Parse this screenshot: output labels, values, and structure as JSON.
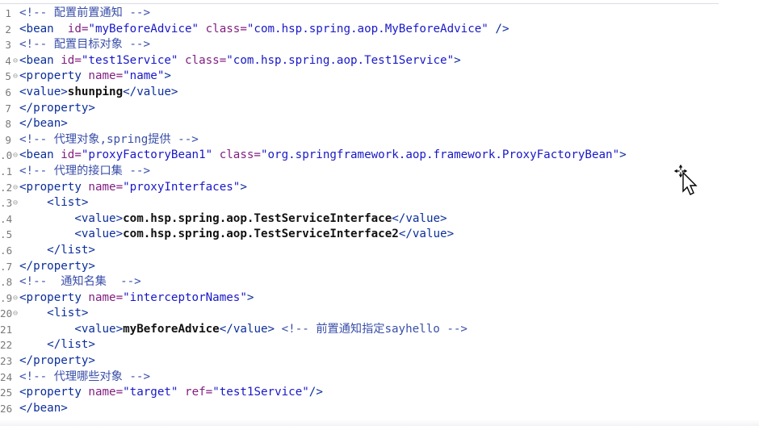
{
  "editor": {
    "lines": [
      {
        "number": "1",
        "fold": "",
        "indent": "",
        "segments": [
          {
            "t": "comment",
            "v": "<!-- 配置前置通知 -->"
          }
        ]
      },
      {
        "number": "2",
        "fold": "",
        "indent": "",
        "segments": [
          {
            "t": "tag",
            "v": "<bean  "
          },
          {
            "t": "attr",
            "v": "id="
          },
          {
            "t": "val",
            "v": "\"myBeforeAdvice\""
          },
          {
            "t": "tag",
            "v": " "
          },
          {
            "t": "attr",
            "v": "class="
          },
          {
            "t": "val",
            "v": "\"com.hsp.spring.aop.MyBeforeAdvice\""
          },
          {
            "t": "tag",
            "v": " />"
          }
        ]
      },
      {
        "number": "3",
        "fold": "",
        "indent": "",
        "segments": [
          {
            "t": "comment",
            "v": "<!-- 配置目标对象 -->"
          }
        ]
      },
      {
        "number": "4",
        "fold": "⊖",
        "indent": "",
        "segments": [
          {
            "t": "tag",
            "v": "<bean "
          },
          {
            "t": "attr",
            "v": "id="
          },
          {
            "t": "val",
            "v": "\"test1Service\""
          },
          {
            "t": "tag",
            "v": " "
          },
          {
            "t": "attr",
            "v": "class="
          },
          {
            "t": "val",
            "v": "\"com.hsp.spring.aop.Test1Service\""
          },
          {
            "t": "tag",
            "v": ">"
          }
        ]
      },
      {
        "number": "5",
        "fold": "⊖",
        "indent": "",
        "segments": [
          {
            "t": "tag",
            "v": "<property "
          },
          {
            "t": "attr",
            "v": "name="
          },
          {
            "t": "val",
            "v": "\"name\""
          },
          {
            "t": "tag",
            "v": ">"
          }
        ]
      },
      {
        "number": "6",
        "fold": "",
        "indent": "",
        "segments": [
          {
            "t": "tag",
            "v": "<value>"
          },
          {
            "t": "text",
            "v": "shunping"
          },
          {
            "t": "tag",
            "v": "</value>"
          }
        ]
      },
      {
        "number": "7",
        "fold": "",
        "indent": "",
        "segments": [
          {
            "t": "tag",
            "v": "</property>"
          }
        ]
      },
      {
        "number": "8",
        "fold": "",
        "indent": "",
        "segments": [
          {
            "t": "tag",
            "v": "</bean>"
          }
        ]
      },
      {
        "number": "9",
        "fold": "",
        "indent": "",
        "segments": [
          {
            "t": "comment",
            "v": "<!-- 代理对象,spring提供 -->"
          }
        ]
      },
      {
        "number": ".0",
        "fold": "⊖",
        "indent": "",
        "segments": [
          {
            "t": "tag",
            "v": "<bean "
          },
          {
            "t": "attr",
            "v": "id="
          },
          {
            "t": "val",
            "v": "\"proxyFactoryBean1\""
          },
          {
            "t": "tag",
            "v": " "
          },
          {
            "t": "attr",
            "v": "class="
          },
          {
            "t": "val",
            "v": "\"org.springframework.aop.framework.ProxyFactoryBean\""
          },
          {
            "t": "tag",
            "v": ">"
          }
        ]
      },
      {
        "number": ".1",
        "fold": "",
        "indent": "",
        "segments": [
          {
            "t": "comment",
            "v": "<!-- 代理的接口集 -->"
          }
        ]
      },
      {
        "number": ".2",
        "fold": "⊖",
        "indent": "",
        "segments": [
          {
            "t": "tag",
            "v": "<property "
          },
          {
            "t": "attr",
            "v": "name="
          },
          {
            "t": "val",
            "v": "\"proxyInterfaces\""
          },
          {
            "t": "tag",
            "v": ">"
          }
        ]
      },
      {
        "number": ".3",
        "fold": "⊖",
        "indent": "    ",
        "segments": [
          {
            "t": "tag",
            "v": "<list>"
          }
        ]
      },
      {
        "number": ".4",
        "fold": "",
        "indent": "        ",
        "segments": [
          {
            "t": "tag",
            "v": "<value>"
          },
          {
            "t": "text",
            "v": "com.hsp.spring.aop.TestServiceInterface"
          },
          {
            "t": "tag",
            "v": "</value>"
          }
        ]
      },
      {
        "number": ".5",
        "fold": "",
        "indent": "        ",
        "segments": [
          {
            "t": "tag",
            "v": "<value>"
          },
          {
            "t": "text",
            "v": "com.hsp.spring.aop.TestServiceInterface2"
          },
          {
            "t": "tag",
            "v": "</value>"
          }
        ]
      },
      {
        "number": ".6",
        "fold": "",
        "indent": "    ",
        "segments": [
          {
            "t": "tag",
            "v": "</list>"
          }
        ]
      },
      {
        "number": ".7",
        "fold": "",
        "indent": "",
        "segments": [
          {
            "t": "tag",
            "v": "</property>"
          }
        ]
      },
      {
        "number": ".8",
        "fold": "",
        "indent": "",
        "segments": [
          {
            "t": "comment",
            "v": "<!--  通知名集  -->"
          }
        ]
      },
      {
        "number": ".9",
        "fold": "⊖",
        "indent": "",
        "segments": [
          {
            "t": "tag",
            "v": "<property "
          },
          {
            "t": "attr",
            "v": "name="
          },
          {
            "t": "val",
            "v": "\"interceptorNames\""
          },
          {
            "t": "tag",
            "v": ">"
          }
        ]
      },
      {
        "number": "20",
        "fold": "⊖",
        "indent": "    ",
        "segments": [
          {
            "t": "tag",
            "v": "<list>"
          }
        ]
      },
      {
        "number": "21",
        "fold": "",
        "indent": "        ",
        "segments": [
          {
            "t": "tag",
            "v": "<value>"
          },
          {
            "t": "text",
            "v": "myBeforeAdvice"
          },
          {
            "t": "tag",
            "v": "</value> "
          },
          {
            "t": "comment",
            "v": "<!-- 前置通知指定sayhello -->"
          }
        ]
      },
      {
        "number": "22",
        "fold": "",
        "indent": "    ",
        "segments": [
          {
            "t": "tag",
            "v": "</list>"
          }
        ]
      },
      {
        "number": "23",
        "fold": "",
        "indent": "",
        "segments": [
          {
            "t": "tag",
            "v": "</property>"
          }
        ]
      },
      {
        "number": "24",
        "fold": "",
        "indent": "",
        "segments": [
          {
            "t": "comment",
            "v": "<!-- 代理哪些对象 -->"
          }
        ]
      },
      {
        "number": "25",
        "fold": "",
        "indent": "",
        "segments": [
          {
            "t": "tag",
            "v": "<property "
          },
          {
            "t": "attr",
            "v": "name="
          },
          {
            "t": "val",
            "v": "\"target\""
          },
          {
            "t": "tag",
            "v": " "
          },
          {
            "t": "attr",
            "v": "ref="
          },
          {
            "t": "val",
            "v": "\"test1Service\""
          },
          {
            "t": "tag",
            "v": "/>"
          }
        ]
      },
      {
        "number": "26",
        "fold": "",
        "indent": "",
        "segments": [
          {
            "t": "tag",
            "v": "</bean>"
          }
        ]
      }
    ]
  },
  "cursor": {
    "icon": "move-cursor-icon"
  },
  "colors": {
    "tag": "#0b2e9a",
    "attribute": "#7f1d7f",
    "attribute_value": "#1818c8",
    "comment": "#3a4fa8",
    "text": "#111111",
    "gutter": "#7a7a7a"
  }
}
